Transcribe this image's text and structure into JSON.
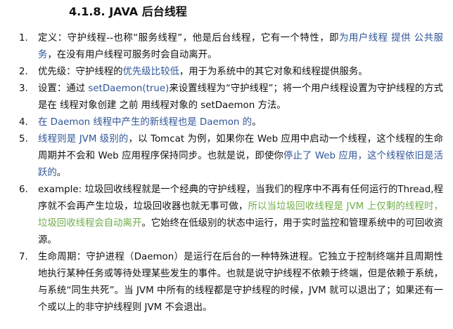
{
  "heading": "4.1.8.  JAVA 后台线程",
  "colors": {
    "text": "#111111",
    "blue": "#2f5597",
    "green": "#70ad47"
  },
  "items": [
    {
      "num": "1.",
      "segments": [
        {
          "text": "定义：守护线程--也称“服务线程”，他是后台线程，它有一个特性，即",
          "color": "plain"
        },
        {
          "text": "为用户线程 提供 公共服务",
          "color": "blue"
        },
        {
          "text": "，在没有用户线程可服务时会自动离开。",
          "color": "plain"
        }
      ]
    },
    {
      "num": "2.",
      "segments": [
        {
          "text": "优先级：守护线程的",
          "color": "plain"
        },
        {
          "text": "优先级比较低",
          "color": "blue"
        },
        {
          "text": "，用于为系统中的其它对象和线程提供服务。",
          "color": "plain"
        }
      ]
    },
    {
      "num": "3.",
      "segments": [
        {
          "text": "设置：通过 ",
          "color": "plain"
        },
        {
          "text": "setDaemon(true)",
          "color": "blue"
        },
        {
          "text": "来设置线程为“守护线程”；将一个用户线程设置为守护线程的方式是在 线程对象创建 之前 用线程对象的 setDaemon 方法。",
          "color": "plain"
        }
      ]
    },
    {
      "num": "4.",
      "segments": [
        {
          "text": "在 Daemon 线程中产生的新线程也是 Daemon 的",
          "color": "blue"
        },
        {
          "text": "。",
          "color": "plain"
        }
      ]
    },
    {
      "num": "5.",
      "segments": [
        {
          "text": "线程则是 JVM 级别的",
          "color": "blue"
        },
        {
          "text": "，以 Tomcat 为例，如果你在 Web 应用中启动一个线程，这个线程的生命周期并不会和 Web 应用程序保持同步。也就是说，即使你",
          "color": "plain"
        },
        {
          "text": "停止了 Web 应用，这个线程依旧是活跃的",
          "color": "blue"
        },
        {
          "text": "。",
          "color": "plain"
        }
      ]
    },
    {
      "num": "6.",
      "segments": [
        {
          "text": "example: 垃圾回收线程就是一个经典的守护线程，当我们的程序中不再有任何运行的Thread,程序就不会再产生垃圾，垃圾回收器也就无事可做，",
          "color": "plain"
        },
        {
          "text": "所以当垃圾回收线程是 JVM 上仅剩的线程时，垃圾回收线程会自动离开",
          "color": "green"
        },
        {
          "text": "。它始终在低级别的状态中运行，用于实时监控和管理系统中的可回收资源。",
          "color": "plain"
        }
      ]
    },
    {
      "num": "7.",
      "segments": [
        {
          "text": "生命周期：守护进程（Daemon）是运行在后台的一种特殊进程。它独立于控制终端并且周期性地执行某种任务或等待处理某些发生的事件。也就是说守护线程不依赖于终端，但是依赖于系统，与系统“同生共死”。当 JVM 中所有的线程都是守护线程的时候，JVM 就可以退出了；如果还有一个或以上的非守护线程则 JVM 不会退出。",
          "color": "plain"
        }
      ]
    }
  ]
}
